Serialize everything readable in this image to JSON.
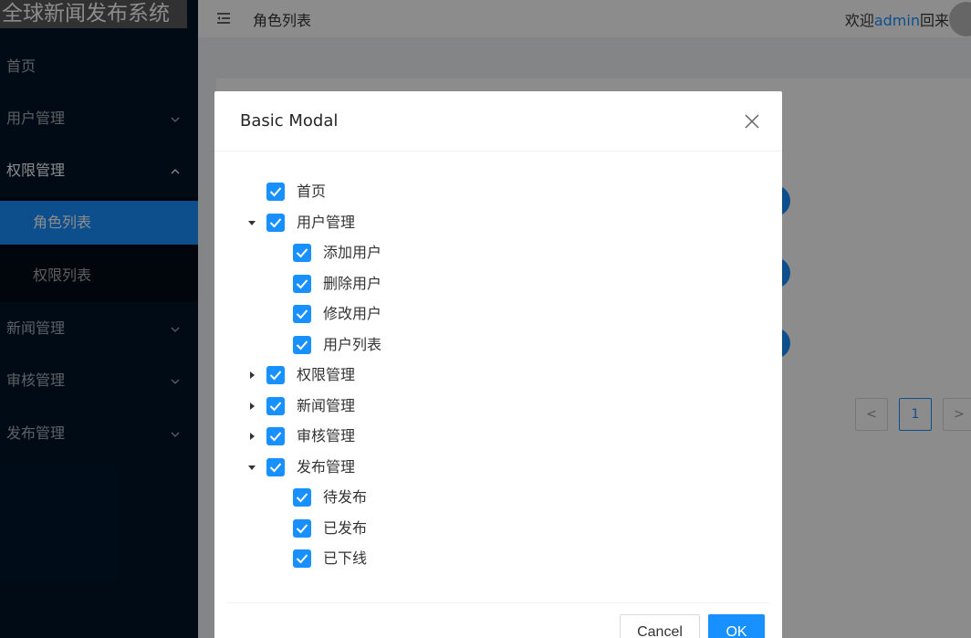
{
  "app": {
    "brand": "全球新闻发布系统"
  },
  "sidebar": {
    "items": [
      {
        "label": "首页",
        "has_children": false
      },
      {
        "label": "用户管理",
        "has_children": true,
        "chevron": "down"
      },
      {
        "label": "权限管理",
        "has_children": true,
        "chevron": "up",
        "open": true
      },
      {
        "label": "新闻管理",
        "has_children": true,
        "chevron": "down"
      },
      {
        "label": "审核管理",
        "has_children": true,
        "chevron": "down"
      },
      {
        "label": "发布管理",
        "has_children": true,
        "chevron": "down"
      }
    ],
    "submenu": [
      {
        "label": "角色列表",
        "selected": true
      },
      {
        "label": "权限列表",
        "selected": false
      }
    ]
  },
  "header": {
    "title": "角色列表",
    "welcome_prefix": "欢迎",
    "username": "admin",
    "welcome_suffix": "回来"
  },
  "pagination": {
    "current": "1",
    "prev": "<",
    "next": ">"
  },
  "modal": {
    "title": "Basic Modal",
    "tree": [
      {
        "label": "首页",
        "checked": true,
        "level": 0,
        "switcher": "none"
      },
      {
        "label": "用户管理",
        "checked": true,
        "level": 0,
        "switcher": "expanded"
      },
      {
        "label": "添加用户",
        "checked": true,
        "level": 1,
        "switcher": "none"
      },
      {
        "label": "删除用户",
        "checked": true,
        "level": 1,
        "switcher": "none"
      },
      {
        "label": "修改用户",
        "checked": true,
        "level": 1,
        "switcher": "none"
      },
      {
        "label": "用户列表",
        "checked": true,
        "level": 1,
        "switcher": "none"
      },
      {
        "label": "权限管理",
        "checked": true,
        "level": 0,
        "switcher": "collapsed"
      },
      {
        "label": "新闻管理",
        "checked": true,
        "level": 0,
        "switcher": "collapsed"
      },
      {
        "label": "审核管理",
        "checked": true,
        "level": 0,
        "switcher": "collapsed"
      },
      {
        "label": "发布管理",
        "checked": true,
        "level": 0,
        "switcher": "expanded"
      },
      {
        "label": "待发布",
        "checked": true,
        "level": 1,
        "switcher": "none"
      },
      {
        "label": "已发布",
        "checked": true,
        "level": 1,
        "switcher": "none"
      },
      {
        "label": "已下线",
        "checked": true,
        "level": 1,
        "switcher": "none"
      }
    ],
    "cancel_label": "Cancel",
    "ok_label": "OK"
  },
  "colors": {
    "primary": "#1890ff",
    "sidebar_bg": "#001529",
    "submenu_bg": "#000c17"
  }
}
